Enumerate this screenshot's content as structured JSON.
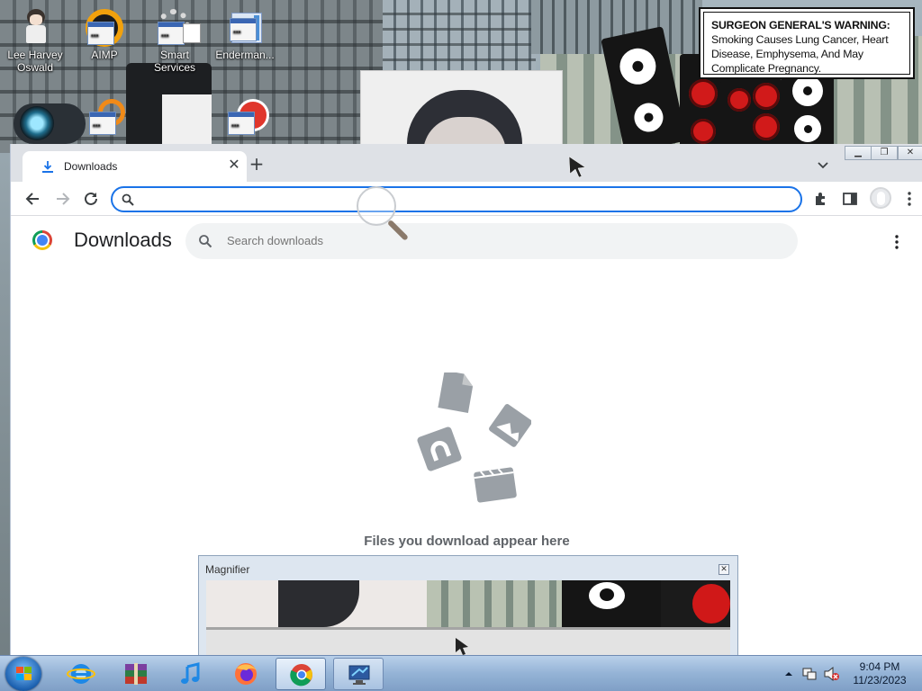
{
  "desktop": {
    "warning_heading": "SURGEON GENERAL'S WARNING:",
    "warning_body": "Smoking Causes Lung Cancer, Heart Disease, Emphysema, And May Complicate Pregnancy.",
    "icons": [
      {
        "label": "Lee Harvey Oswald",
        "icon": "user-avatar-icon"
      },
      {
        "label": "AIMP",
        "icon": "aimp-icon"
      },
      {
        "label": "Smart Services",
        "icon": "gear-app-icon"
      },
      {
        "label": "Enderman...",
        "icon": "app-window-icon"
      }
    ]
  },
  "browser": {
    "tab_title": "Downloads",
    "omnibox_value": "",
    "page_title": "Downloads",
    "search_placeholder": "Search downloads",
    "empty_message": "Files you download appear here"
  },
  "magnifier": {
    "title": "Magnifier"
  },
  "taskbar": {
    "apps": [
      "start-orb",
      "internet-explorer-icon",
      "winrar-icon",
      "itunes-icon",
      "firefox-icon",
      "chrome-icon",
      "remote-desktop-icon"
    ],
    "time": "9:04 PM",
    "date": "11/23/2023"
  },
  "colors": {
    "accent": "#1a73e8",
    "tab_strip": "#dee1e6",
    "taskbar": "#94b3d6"
  }
}
